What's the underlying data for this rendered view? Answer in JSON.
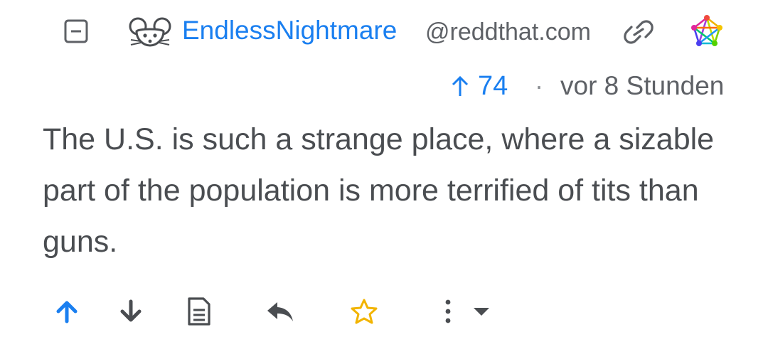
{
  "header": {
    "username": "EndlessNightmare",
    "instance": "@reddthat.com",
    "icons": [
      "collapse-icon",
      "mouse-avatar-icon",
      "link-icon",
      "fediverse-icon"
    ]
  },
  "meta": {
    "score": "74",
    "separator": "·",
    "time": "vor 8 Stunden"
  },
  "comment": {
    "text": "The U.S. is such a strange place, where a sizable part of the population is more terrified of tits than guns."
  },
  "actions": {
    "icons": [
      "upvote-icon",
      "downvote-icon",
      "view-source-icon",
      "reply-icon",
      "save-star-icon",
      "more-options-icon"
    ]
  },
  "colors": {
    "accent": "#1a7ff0",
    "text": "#4a4d51",
    "muted": "#5e6166",
    "star": "#f2b400"
  }
}
